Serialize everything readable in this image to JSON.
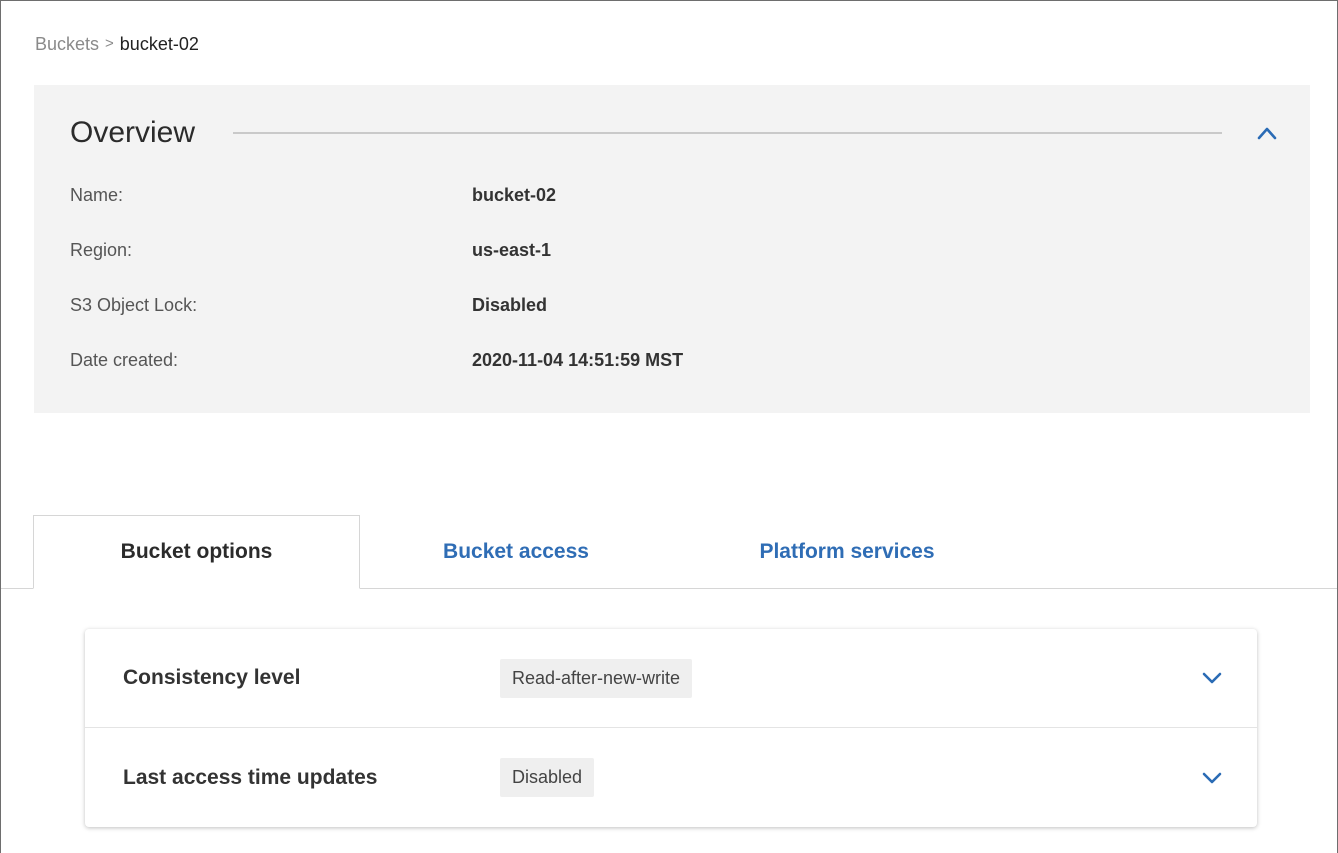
{
  "breadcrumb": {
    "parent": "Buckets",
    "separator": ">",
    "current": "bucket-02"
  },
  "overview": {
    "title": "Overview",
    "toggle_icon": "chevron-up-icon",
    "fields": [
      {
        "label": "Name:",
        "value": "bucket-02"
      },
      {
        "label": "Region:",
        "value": "us-east-1"
      },
      {
        "label": "S3 Object Lock:",
        "value": "Disabled"
      },
      {
        "label": "Date created:",
        "value": "2020-11-04 14:51:59 MST"
      }
    ]
  },
  "tabs": [
    {
      "label": "Bucket options",
      "active": true
    },
    {
      "label": "Bucket access",
      "active": false
    },
    {
      "label": "Platform services",
      "active": false
    }
  ],
  "bucket_options": [
    {
      "label": "Consistency level",
      "value": "Read-after-new-write",
      "toggle_icon": "chevron-down-icon"
    },
    {
      "label": "Last access time updates",
      "value": "Disabled",
      "toggle_icon": "chevron-down-icon"
    }
  ],
  "colors": {
    "accent": "#2f6db5",
    "panel_bg": "#f3f3f3"
  }
}
